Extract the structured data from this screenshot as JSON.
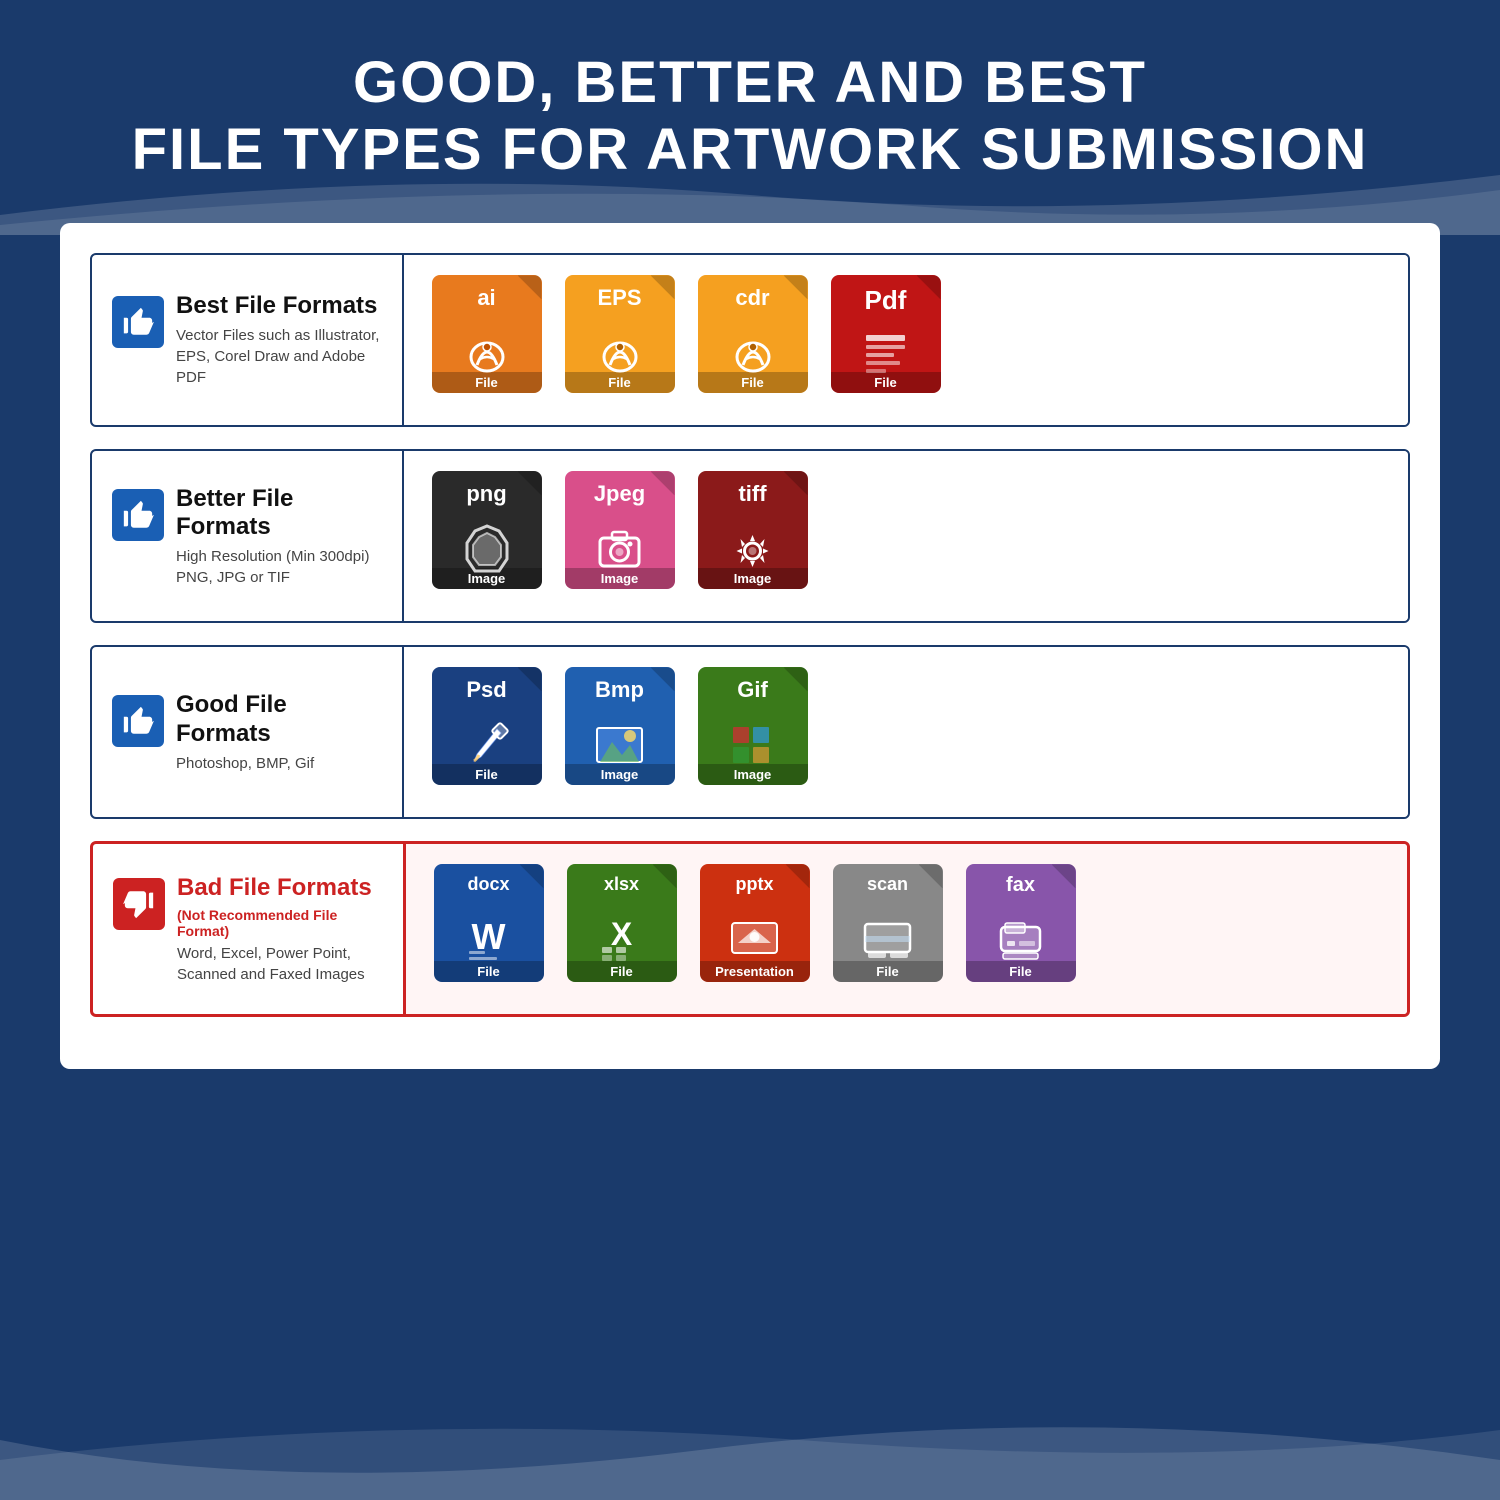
{
  "header": {
    "line1": "GOOD, BETTER AND BEST",
    "line2": "FILE TYPES FOR ARTWORK SUBMISSION"
  },
  "sections": [
    {
      "id": "best",
      "thumbType": "up",
      "labelTitle": "Best File Formats",
      "labelSubtitle": null,
      "labelDesc": "Vector Files such as Illustrator, EPS, Corel Draw and Adobe PDF",
      "isBad": false,
      "files": [
        {
          "ext": "ai",
          "color": "orange",
          "label": "File",
          "icon": "pen"
        },
        {
          "ext": "EPS",
          "color": "orange-light",
          "label": "File",
          "icon": "pen"
        },
        {
          "ext": "cdr",
          "color": "orange-light",
          "label": "File",
          "icon": "pen"
        },
        {
          "ext": "Pdf",
          "color": "red-dark",
          "label": "File",
          "icon": "doc"
        }
      ]
    },
    {
      "id": "better",
      "thumbType": "up",
      "labelTitle": "Better File Formats",
      "labelSubtitle": null,
      "labelDesc": "High Resolution (Min 300dpi) PNG, JPG or TIF",
      "isBad": false,
      "files": [
        {
          "ext": "png",
          "color": "black",
          "label": "Image",
          "icon": "star"
        },
        {
          "ext": "Jpeg",
          "color": "pink",
          "label": "Image",
          "icon": "camera"
        },
        {
          "ext": "tiff",
          "color": "dark-red",
          "label": "Image",
          "icon": "gear"
        }
      ]
    },
    {
      "id": "good",
      "thumbType": "up",
      "labelTitle": "Good File Formats",
      "labelSubtitle": null,
      "labelDesc": "Photoshop, BMP, Gif",
      "isBad": false,
      "files": [
        {
          "ext": "Psd",
          "color": "blue-dark",
          "label": "File",
          "icon": "brush"
        },
        {
          "ext": "Bmp",
          "color": "blue-mid",
          "label": "Image",
          "icon": "mountain"
        },
        {
          "ext": "Gif",
          "color": "green-dark",
          "label": "Image",
          "icon": "grid"
        }
      ]
    },
    {
      "id": "bad",
      "thumbType": "down",
      "labelTitle": "Bad File Formats",
      "labelSubtitle": "(Not Recommended File Format)",
      "labelDesc": "Word, Excel, Power Point, Scanned and Faxed Images",
      "isBad": true,
      "files": [
        {
          "ext": "docx",
          "color": "blue-word",
          "label": "File",
          "icon": "word"
        },
        {
          "ext": "xlsx",
          "color": "green-excel",
          "label": "File",
          "icon": "excel"
        },
        {
          "ext": "pptx",
          "color": "red-ppt",
          "label": "Presentation",
          "icon": "ppt"
        },
        {
          "ext": "scan",
          "color": "gray-scan",
          "label": "File",
          "icon": "scan"
        },
        {
          "ext": "fax",
          "color": "purple-fax",
          "label": "File",
          "icon": "fax"
        }
      ]
    }
  ]
}
